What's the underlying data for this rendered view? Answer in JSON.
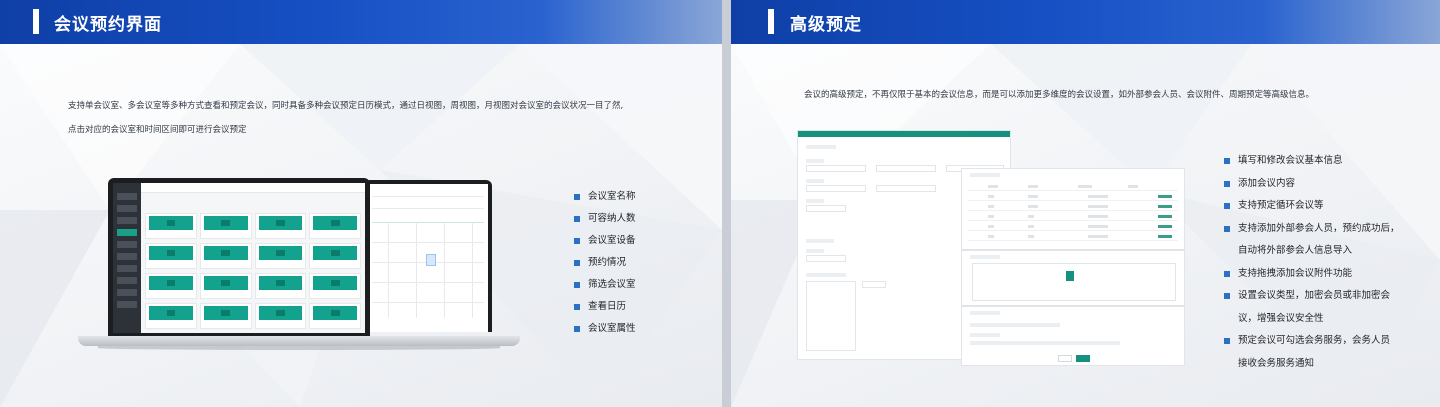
{
  "left_slide": {
    "title": "会议预约界面",
    "description_line1": "支持单会议室、多会议室等多种方式查看和预定会议，同时具备多种会议预定日历模式，通过日视图，周视图，月视图对会议室的会议状况一目了然,",
    "description_line2": "点击对应的会议室和时间区间即可进行会议预定",
    "features": [
      "会议室名称",
      "可容纳人数",
      "会议室设备",
      "预约情况",
      "筛选会议室",
      "查看日历",
      "会议室属性"
    ]
  },
  "right_slide": {
    "title": "高级预定",
    "description": "会议的高级预定，不再仅限于基本的会议信息，而是可以添加更多维度的会议设置，如外部参会人员、会议附件、周期预定等高级信息。",
    "features": [
      {
        "line1": "填写和修改会议基本信息",
        "line2": ""
      },
      {
        "line1": "添加会议内容",
        "line2": ""
      },
      {
        "line1": "支持预定循环会议等",
        "line2": ""
      },
      {
        "line1": "支持添加外部参会人员，预约成功后，",
        "line2": "自动将外部参会人信息导入"
      },
      {
        "line1": "支持拖拽添加会议附件功能",
        "line2": ""
      },
      {
        "line1": "设置会议类型，加密会员或非加密会",
        "line2": "议，增强会议安全性"
      },
      {
        "line1": "预定会议可勾选会务服务，会务人员",
        "line2": "接收会务服务通知"
      }
    ]
  },
  "colors": {
    "header_blue": "#1650c4",
    "bullet_blue": "#2c6fc7",
    "app_green": "#16917d"
  }
}
